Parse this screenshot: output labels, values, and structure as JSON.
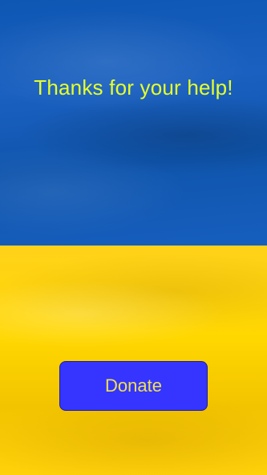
{
  "screen": {
    "headline": "Thanks for your help!",
    "donate_label": "Donate"
  },
  "colors": {
    "flag_blue": "#0e57b3",
    "flag_yellow": "#ffd700",
    "headline_text": "#e6ff2a",
    "button_bg": "#3535ff",
    "button_text": "#f0e050"
  }
}
